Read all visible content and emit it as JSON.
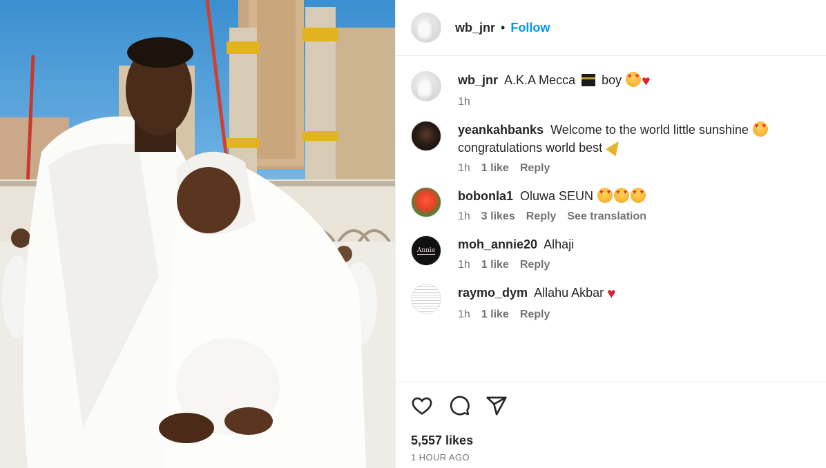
{
  "post": {
    "author": "wb_jnr",
    "separator": "•",
    "follow_label": "Follow",
    "likes": "5,557 likes",
    "timestamp": "1 HOUR AGO"
  },
  "comments": [
    {
      "user": "wb_jnr",
      "text_a": "A.K.A Mecca",
      "text_b": "boy",
      "time": "1h"
    },
    {
      "user": "yeankahbanks",
      "text_a": "Welcome to the world little sunshine",
      "text_b": "congratulations world best",
      "time": "1h",
      "likes": "1 like",
      "reply": "Reply"
    },
    {
      "user": "bobonla1",
      "text_a": "Oluwa SEUN",
      "time": "1h",
      "likes": "3 likes",
      "reply": "Reply",
      "translate": "See translation"
    },
    {
      "user": "moh_annie20",
      "text_a": "Alhaji",
      "time": "1h",
      "likes": "1 like",
      "reply": "Reply",
      "avatar_text": "Annie"
    },
    {
      "user": "raymo_dym",
      "text_a": "Allahu Akbar",
      "time": "1h",
      "likes": "1 like",
      "reply": "Reply"
    }
  ],
  "icons": {
    "like": "heart-outline-icon",
    "comment": "speech-bubble-icon",
    "share": "paper-plane-icon"
  },
  "colors": {
    "follow": "#0095f6",
    "text": "#262626",
    "meta": "#737373",
    "heart": "#e11d2e"
  }
}
